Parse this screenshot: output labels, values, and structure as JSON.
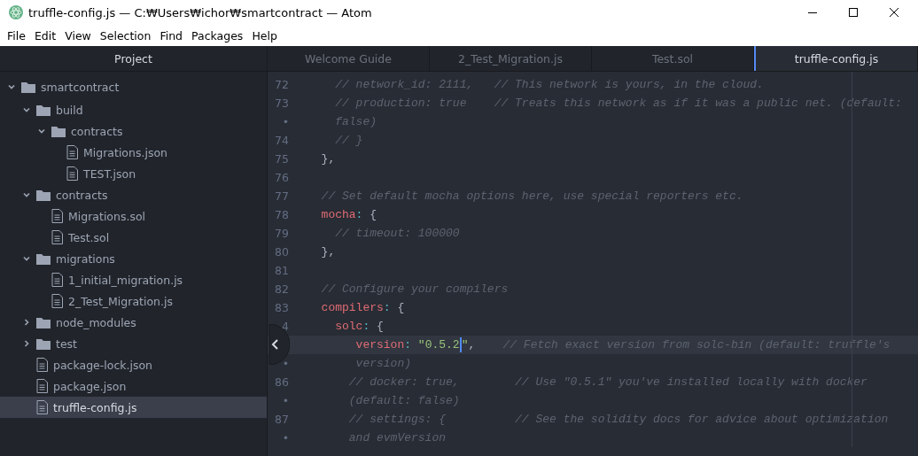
{
  "window": {
    "title": "truffle-config.js — C:₩Users₩ichor₩smartcontract — Atom"
  },
  "menu": [
    "File",
    "Edit",
    "View",
    "Selection",
    "Find",
    "Packages",
    "Help"
  ],
  "sidebar": {
    "title": "Project",
    "tree": [
      {
        "name": "smartcontract",
        "kind": "folder",
        "expanded": true,
        "selected": false,
        "children": [
          {
            "name": "build",
            "kind": "folder",
            "expanded": true,
            "selected": false,
            "children": [
              {
                "name": "contracts",
                "kind": "folder",
                "expanded": true,
                "selected": false,
                "children": [
                  {
                    "name": "Migrations.json",
                    "kind": "file",
                    "selected": false
                  },
                  {
                    "name": "TEST.json",
                    "kind": "file",
                    "selected": false
                  }
                ]
              }
            ]
          },
          {
            "name": "contracts",
            "kind": "folder",
            "expanded": true,
            "selected": false,
            "children": [
              {
                "name": "Migrations.sol",
                "kind": "file",
                "selected": false
              },
              {
                "name": "Test.sol",
                "kind": "file",
                "selected": false
              }
            ]
          },
          {
            "name": "migrations",
            "kind": "folder",
            "expanded": true,
            "selected": false,
            "children": [
              {
                "name": "1_initial_migration.js",
                "kind": "file",
                "selected": false
              },
              {
                "name": "2_Test_Migration.js",
                "kind": "file",
                "selected": false
              }
            ]
          },
          {
            "name": "node_modules",
            "kind": "folder",
            "expanded": false,
            "selected": false
          },
          {
            "name": "test",
            "kind": "folder",
            "expanded": false,
            "selected": false
          },
          {
            "name": "package-lock.json",
            "kind": "file",
            "selected": false
          },
          {
            "name": "package.json",
            "kind": "file",
            "selected": false
          },
          {
            "name": "truffle-config.js",
            "kind": "file",
            "selected": true
          }
        ]
      }
    ]
  },
  "tabs": [
    {
      "label": "Welcome Guide",
      "selected": false
    },
    {
      "label": "2_Test_Migration.js",
      "selected": false
    },
    {
      "label": "Test.sol",
      "selected": false
    },
    {
      "label": "truffle-config.js",
      "selected": true
    }
  ],
  "editor": {
    "lines": [
      {
        "number": "72",
        "current": false,
        "tokens": [
          {
            "kind": "comment",
            "text": "    // network_id: 2111,   // This network is yours, in the cloud."
          }
        ]
      },
      {
        "number": "73",
        "current": false,
        "tokens": [
          {
            "kind": "comment",
            "text": "    // production: true    // Treats this network as if it was a public net. (default:"
          }
        ]
      },
      {
        "number": "•",
        "current": false,
        "tokens": [
          {
            "kind": "comment",
            "text": "    false)"
          }
        ]
      },
      {
        "number": "74",
        "current": false,
        "tokens": [
          {
            "kind": "comment",
            "text": "    // }"
          }
        ]
      },
      {
        "number": "75",
        "current": false,
        "tokens": [
          {
            "kind": "plain",
            "text": "  },"
          }
        ]
      },
      {
        "number": "76",
        "current": false
      },
      {
        "number": "77",
        "current": false,
        "tokens": [
          {
            "kind": "comment",
            "text": "  // Set default mocha options here, use special reporters etc."
          }
        ]
      },
      {
        "number": "78",
        "current": false,
        "tokens": [
          {
            "kind": "key",
            "text": "  mocha"
          },
          {
            "kind": "punct",
            "text": ":"
          },
          {
            "kind": "plain",
            "text": " {"
          }
        ]
      },
      {
        "number": "79",
        "current": false,
        "tokens": [
          {
            "kind": "comment",
            "text": "    // timeout: 100000"
          }
        ]
      },
      {
        "number": "80",
        "current": false,
        "tokens": [
          {
            "kind": "plain",
            "text": "  },"
          }
        ]
      },
      {
        "number": "81",
        "current": false
      },
      {
        "number": "82",
        "current": false,
        "tokens": [
          {
            "kind": "comment",
            "text": "  // Configure your compilers"
          }
        ]
      },
      {
        "number": "83",
        "current": false,
        "tokens": [
          {
            "kind": "key",
            "text": "  compilers"
          },
          {
            "kind": "punct",
            "text": ":"
          },
          {
            "kind": "plain",
            "text": " {"
          }
        ]
      },
      {
        "number": "4",
        "current": false,
        "tokens": [
          {
            "kind": "key",
            "text": "    solc"
          },
          {
            "kind": "punct",
            "text": ":"
          },
          {
            "kind": "plain",
            "text": " {"
          }
        ]
      },
      {
        "current": true,
        "tokens": [
          {
            "kind": "key",
            "text": "       version"
          },
          {
            "kind": "punct",
            "text": ":"
          },
          {
            "kind": "string",
            "text": " \"0.5.2",
            "caret": true
          },
          {
            "kind": "string",
            "text": "\""
          },
          {
            "kind": "plain",
            "text": ","
          },
          {
            "kind": "comment",
            "text": "    // Fetch exact version from solc-bin (default: truffle's"
          }
        ]
      },
      {
        "number": "•",
        "current": false,
        "tokens": [
          {
            "kind": "comment",
            "text": "       version)"
          }
        ]
      },
      {
        "number": "86",
        "current": false,
        "tokens": [
          {
            "kind": "comment",
            "text": "      // docker: true,        // Use \"0.5.1\" you've installed locally with docker"
          }
        ]
      },
      {
        "number": "•",
        "current": false,
        "tokens": [
          {
            "kind": "comment",
            "text": "      (default: false)"
          }
        ]
      },
      {
        "number": "87",
        "current": false,
        "tokens": [
          {
            "kind": "comment",
            "text": "      // settings: {          // See the solidity docs for advice about optimization"
          }
        ]
      },
      {
        "number": "•",
        "current": false,
        "tokens": [
          {
            "kind": "comment",
            "text": "      and evmVersion"
          }
        ]
      }
    ]
  }
}
